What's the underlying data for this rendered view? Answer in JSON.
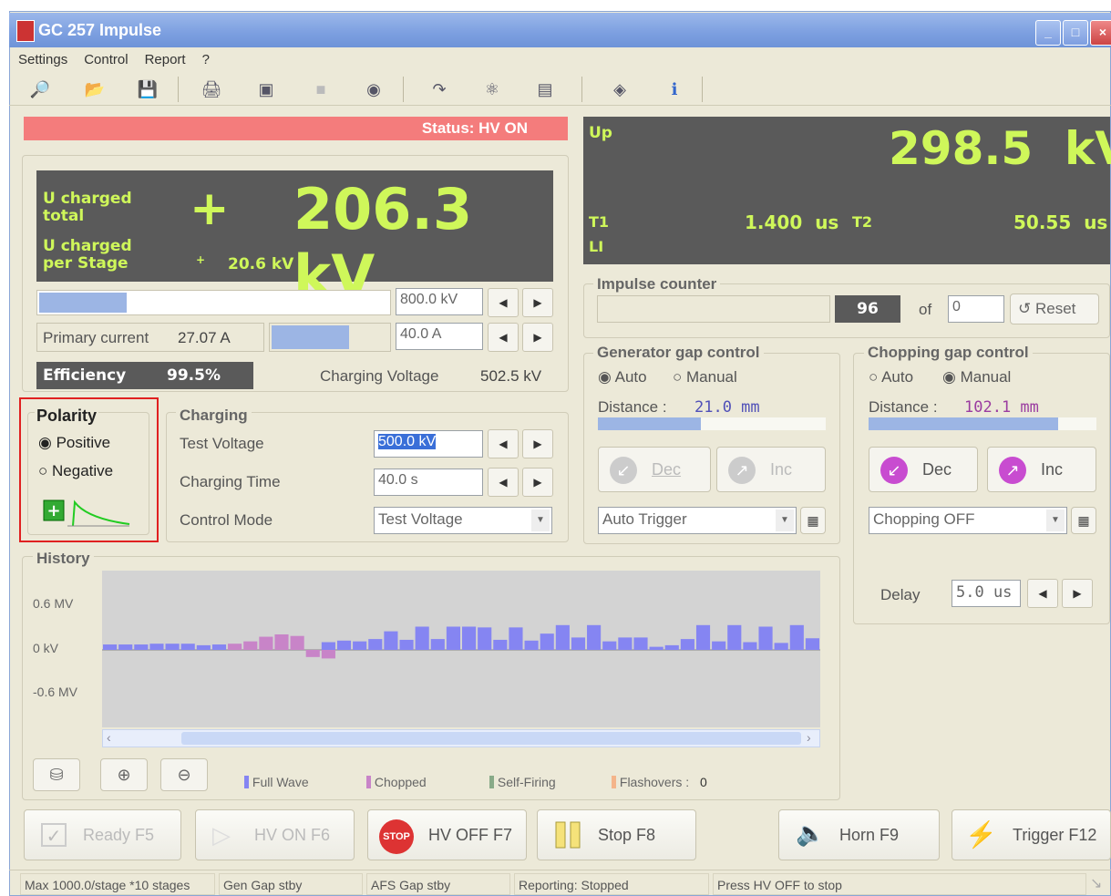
{
  "window": {
    "title": "GC 257 Impulse",
    "min": "_",
    "max": "□",
    "close": "×"
  },
  "menu": [
    "Settings",
    "Control",
    "Report",
    "?"
  ],
  "status_banner": "Status: HV ON",
  "charged": {
    "total_label": "U charged total",
    "sign": "+",
    "total_value": "206.3 kV",
    "stage_label": "U charged per Stage",
    "stage_sign": "+",
    "stage_value": "20.6 kV",
    "voltage_limit": "800.0 kV",
    "voltage_fill": 0.25,
    "primary_label": "Primary current",
    "primary_value": "27.07 A",
    "primary_fill": 0.65,
    "current_limit": "40.0 A",
    "efficiency_label": "Efficiency",
    "efficiency_value": "99.5%",
    "charging_voltage_label": "Charging Voltage",
    "charging_voltage_value": "502.5 kV"
  },
  "polarity": {
    "title": "Polarity",
    "positive": "Positive",
    "negative": "Negative",
    "selected": "Positive"
  },
  "charging": {
    "title": "Charging",
    "test_voltage_label": "Test Voltage",
    "test_voltage": "500.0 kV",
    "charging_time_label": "Charging Time",
    "charging_time": "40.0 s",
    "control_mode_label": "Control Mode",
    "control_mode": "Test Voltage"
  },
  "up_display": {
    "up_label": "Up",
    "up_value": "298.5  kV",
    "t1_label": "T1",
    "t1_value": "1.400  us",
    "t2_label": "T2",
    "t2_value": "50.55  us",
    "li_label": "LI"
  },
  "impulse_counter": {
    "title": "Impulse counter",
    "count": "96",
    "of_label": "of",
    "limit": "0",
    "reset": "Reset"
  },
  "gen_gap": {
    "title": "Generator gap control",
    "auto": "Auto",
    "manual": "Manual",
    "selected": "Auto",
    "distance_label": "Distance :",
    "distance": "21.0 mm",
    "fill": 0.45,
    "dec": "Dec",
    "inc": "Inc",
    "trigger": "Auto Trigger"
  },
  "chop_gap": {
    "title": "Chopping gap control",
    "auto": "Auto",
    "manual": "Manual",
    "selected": "Manual",
    "distance_label": "Distance :",
    "distance": "102.1 mm",
    "fill": 0.83,
    "dec": "Dec",
    "inc": "Inc",
    "mode": "Chopping OFF",
    "delay_label": "Delay",
    "delay": "5.0 us"
  },
  "history": {
    "title": "History",
    "ticks": [
      "0.6 MV",
      "0 kV",
      "-0.6 MV"
    ],
    "legend": {
      "full": "Full Wave",
      "chopped": "Chopped",
      "self": "Self-Firing",
      "flash": "Flashovers :",
      "flash_count": "0"
    },
    "colors": {
      "full": "#8585f2",
      "chopped": "#c884c8",
      "self": "#8a8",
      "flash": "#f4b48a"
    }
  },
  "chart_data": {
    "type": "bar",
    "ylabel": "",
    "ylim": [
      -0.6,
      0.6
    ],
    "series": [
      {
        "name": "Full Wave",
        "values": [
          0.07,
          0.07,
          0.07,
          0.08,
          0.08,
          0.08,
          0.06,
          0.07,
          null,
          null,
          null,
          null,
          null,
          null,
          0.1,
          0.12,
          0.11,
          0.14,
          0.24,
          0.13,
          0.3,
          0.14,
          0.3,
          0.3,
          0.29,
          0.13,
          0.29,
          0.12,
          0.21,
          0.32,
          0.16,
          0.32,
          0.11,
          0.16,
          0.16,
          0.04,
          0.06,
          0.14,
          0.32,
          0.11,
          0.32,
          0.1,
          0.3,
          0.09,
          0.32,
          0.15
        ]
      },
      {
        "name": "Chopped",
        "values": [
          null,
          null,
          null,
          null,
          null,
          null,
          null,
          null,
          0.08,
          0.11,
          0.17,
          0.2,
          0.18,
          -0.1,
          -0.12,
          null,
          null,
          null,
          null,
          null,
          null,
          null,
          null,
          null,
          null,
          null,
          null,
          null,
          null,
          null,
          null,
          null,
          null,
          null,
          null,
          null,
          null,
          null,
          null,
          null,
          null,
          null,
          null,
          null,
          null,
          null
        ]
      }
    ]
  },
  "buttons": {
    "ready": "Ready  F5",
    "hvon": "HV ON  F6",
    "hvoff": "HV OFF  F7",
    "stop": "Stop F8",
    "horn": "Horn  F9",
    "trigger": "Trigger  F12",
    "stop_sign": "STOP"
  },
  "statusbar": [
    "Max 1000.0/stage *10 stages",
    "Gen Gap stby",
    "AFS Gap stby",
    "Reporting: Stopped",
    "Press HV OFF to stop"
  ]
}
